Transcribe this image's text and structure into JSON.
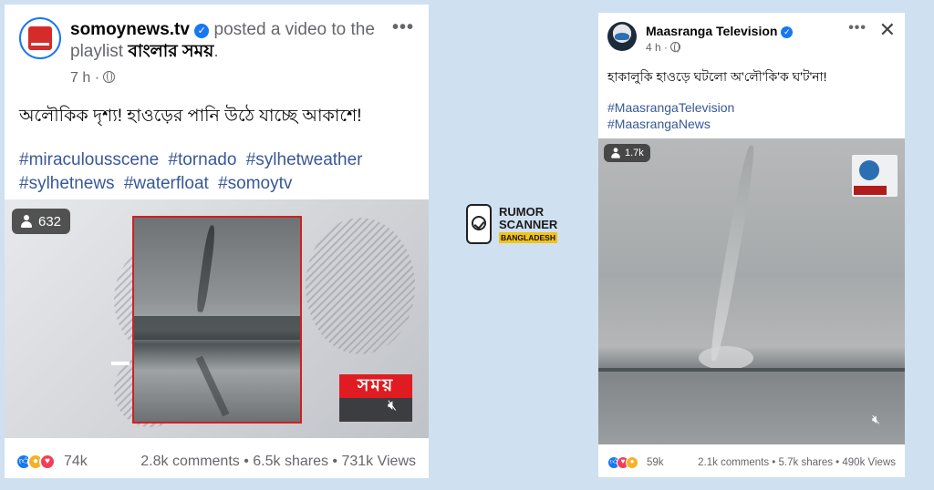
{
  "left_post": {
    "page_name": "somoynews.tv",
    "action_text": "posted a video to the playlist",
    "playlist_name": "বাংলার সময়",
    "trailing_period": ".",
    "time": "7 h",
    "separator": "·",
    "more_icon": "more-dots-icon",
    "caption": "অলৌকিক দৃশ্য! হাওড়ের পানি উঠে যাচ্ছে আকাশে!",
    "hashtags": [
      "#miraculousscene",
      "#tornado",
      "#sylhetweather",
      "#sylhetnews",
      "#waterfloat",
      "#somoytv"
    ],
    "viewer_count": "632",
    "brand_overlay": "সময়",
    "reactions": [
      "like",
      "wow",
      "love"
    ],
    "reaction_count": "74k",
    "stats": "2.8k comments • 6.5k shares • 731k Views"
  },
  "logo": {
    "line1": "RUMOR",
    "line2": "SCANNER",
    "line3": "BANGLADESH",
    "accent_color": "#f2c21b"
  },
  "right_post": {
    "page_name": "Maasranga Television",
    "time": "4 h",
    "separator": "·",
    "more_icon": "more-dots-icon",
    "close_icon": "close-icon",
    "close_glyph": "✕",
    "caption": "হাকালুকি হাওড়ে ঘটলো অ'লৌ'কি'ক ঘ'ট'না!",
    "hashtags": [
      "#MaasrangaTelevision",
      "#MaasrangaNews"
    ],
    "viewer_count": "1.7k",
    "reactions": [
      "like",
      "love",
      "wow"
    ],
    "reaction_count": "59k",
    "stats": "2.1k comments • 5.7k shares • 490k Views"
  },
  "colors": {
    "background": "#cfe0f0",
    "link": "#385898",
    "facebook_blue": "#1877f2",
    "brand_red": "#e01b22"
  }
}
